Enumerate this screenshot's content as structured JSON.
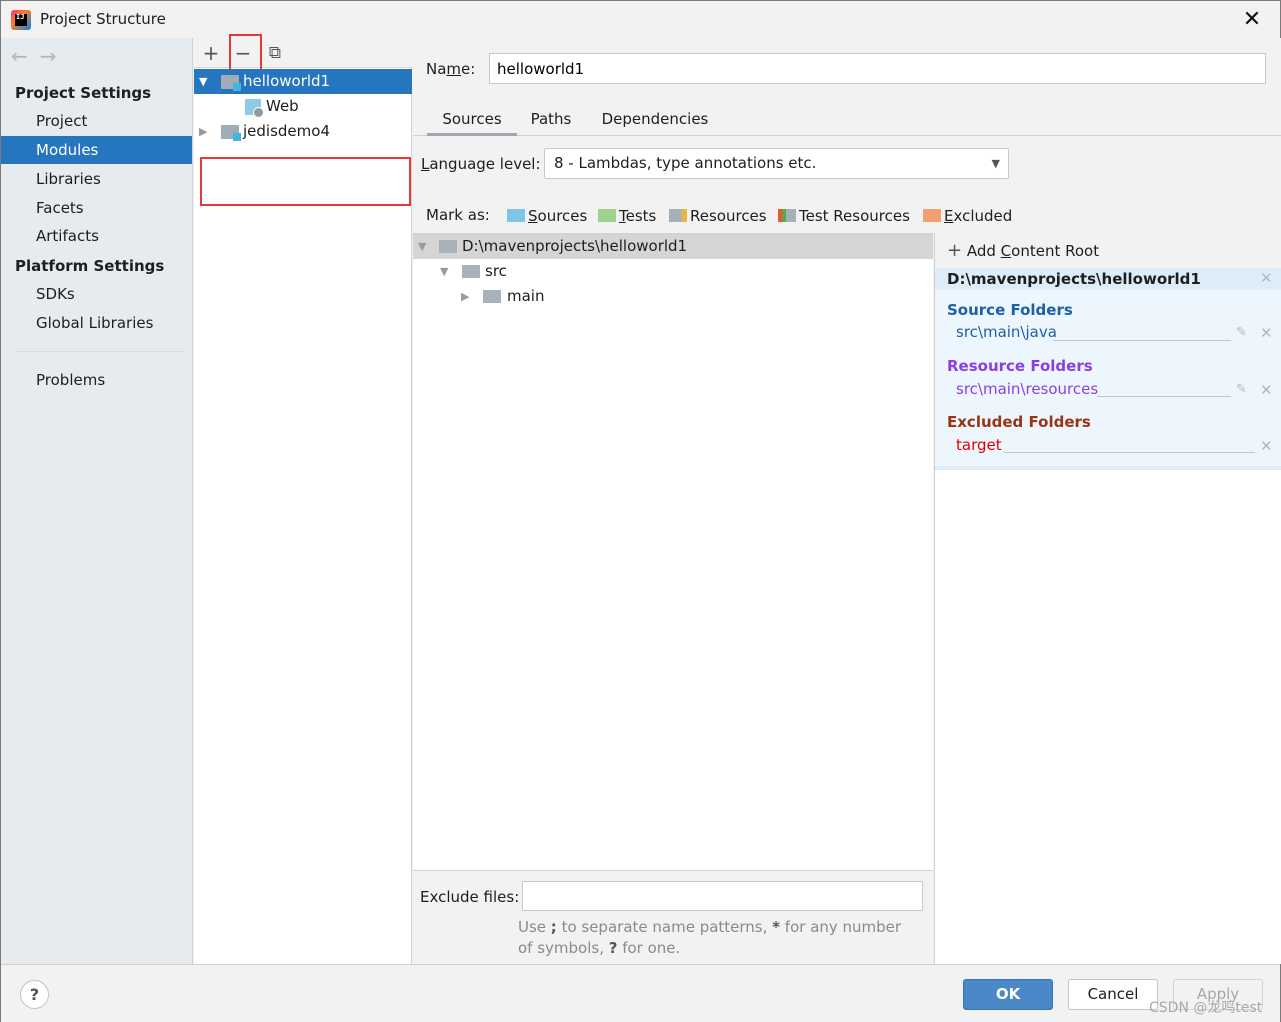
{
  "window": {
    "title": "Project Structure",
    "close_glyph": "✕"
  },
  "sidebar": {
    "back_glyph": "←",
    "forward_glyph": "→",
    "project_settings_header": "Project Settings",
    "platform_settings_header": "Platform Settings",
    "items": [
      {
        "label": "Project",
        "selected": false
      },
      {
        "label": "Modules",
        "selected": true
      },
      {
        "label": "Libraries",
        "selected": false
      },
      {
        "label": "Facets",
        "selected": false
      },
      {
        "label": "Artifacts",
        "selected": false
      },
      {
        "label": "SDKs",
        "selected": false
      },
      {
        "label": "Global Libraries",
        "selected": false
      },
      {
        "label": "Problems",
        "selected": false
      }
    ]
  },
  "modules_panel": {
    "toolbar": {
      "add_glyph": "+",
      "remove_glyph": "−",
      "copy_glyph": "⧉"
    },
    "tree": [
      {
        "label": "helloworld1",
        "expanded": true,
        "selected": true,
        "icon": "module-folder-icon"
      },
      {
        "label": "Web",
        "child": true,
        "icon": "web-facet-icon"
      },
      {
        "label": "jedisdemo4",
        "expanded": false,
        "selected": false,
        "icon": "module-folder-icon"
      }
    ],
    "highlight_color": "#e8383b"
  },
  "details": {
    "name_label_pre": "Na",
    "name_label_ul": "m",
    "name_label_post": "e:",
    "name_value": "helloworld1",
    "tabs": [
      {
        "label": "Sources",
        "active": true
      },
      {
        "label": "Paths",
        "active": false
      },
      {
        "label": "Dependencies",
        "active": false
      }
    ],
    "language_level_ul": "L",
    "language_level_rest": "anguage level:",
    "language_level_value": "8 - Lambdas, type annotations etc.",
    "mark_as_label": "Mark as:",
    "mark_as": [
      {
        "ul": "S",
        "rest": "ources",
        "color": "#7ec6e6",
        "icon": "sources-folder-icon"
      },
      {
        "ul": "T",
        "rest": "ests",
        "color": "#9fd08c",
        "icon": "tests-folder-icon"
      },
      {
        "ul": "",
        "rest": "Resources",
        "color": "#a6b0ba",
        "icon": "resources-folder-icon"
      },
      {
        "ul": "",
        "rest": "Test Resources",
        "color": "#a6b0ba",
        "icon": "test-resources-folder-icon"
      },
      {
        "ul": "E",
        "rest": "xcluded",
        "color": "#f0a071",
        "icon": "excluded-folder-icon"
      }
    ],
    "source_tree": [
      {
        "label": "D:\\mavenprojects\\helloworld1",
        "level": 0,
        "expanded": true,
        "selected": true
      },
      {
        "label": "src",
        "level": 1,
        "expanded": true
      },
      {
        "label": "main",
        "level": 2,
        "expanded": false
      }
    ],
    "exclude_files_label": "Exclude files:",
    "exclude_files_value": "",
    "exclude_hint_1": "Use ",
    "exclude_hint_semi": ";",
    "exclude_hint_2": " to separate name patterns, ",
    "exclude_hint_star": "*",
    "exclude_hint_3": " for any number of symbols, ",
    "exclude_hint_q": "?",
    "exclude_hint_4": " for one."
  },
  "content_roots": {
    "add_glyph": "+",
    "add_pre": " Add ",
    "add_ul": "C",
    "add_post": "ontent Root",
    "root_path": "D:\\mavenprojects\\helloworld1",
    "source_folders_title": "Source Folders",
    "source_folders_color": "#1f5fa6",
    "source_folder_path": "src\\main\\java",
    "resource_folders_title": "Resource Folders",
    "resource_folders_color": "#8c3fe0",
    "resource_folder_path": "src\\main\\resources",
    "excluded_folders_title": "Excluded Folders",
    "excluded_folders_color": "#9a3412",
    "excluded_folder_path": "target",
    "excluded_path_color": "#e00000",
    "remove_glyph": "✕",
    "edit_glyph": "✎"
  },
  "footer": {
    "help_glyph": "?",
    "ok_label": "OK",
    "cancel_label": "Cancel",
    "apply_label": "Apply",
    "watermark": "CSDN @龙鸣test"
  }
}
